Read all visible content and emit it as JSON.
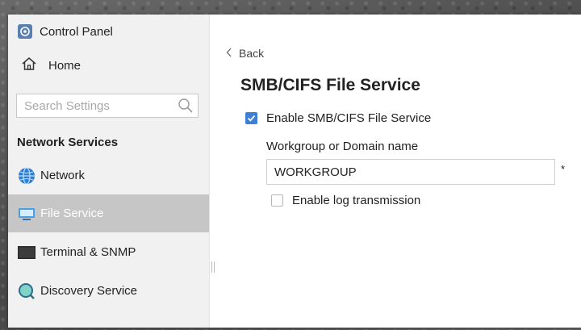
{
  "app": {
    "title": "Control Panel"
  },
  "sidebar": {
    "home_label": "Home",
    "search": {
      "placeholder": "Search Settings",
      "value": ""
    },
    "section_header": "Network Services",
    "items": [
      {
        "label": "Network",
        "icon": "globe-icon"
      },
      {
        "label": "File Service",
        "icon": "file-service-icon",
        "active": true
      },
      {
        "label": "Terminal & SNMP",
        "icon": "terminal-icon"
      },
      {
        "label": "Discovery Service",
        "icon": "discovery-icon"
      }
    ]
  },
  "main": {
    "back_label": "Back",
    "title": "SMB/CIFS File Service",
    "enable_smb": {
      "label": "Enable SMB/CIFS File Service",
      "checked": true
    },
    "workgroup": {
      "label": "Workgroup or Domain name",
      "value": "WORKGROUP",
      "required_mark": "*"
    },
    "enable_log": {
      "label": "Enable log transmission",
      "checked": false
    }
  },
  "colors": {
    "accent": "#3c7fd4",
    "sidebar_bg": "#f1f1f1",
    "active_item_bg": "#c6c6c6",
    "content_bg": "#ffffff"
  }
}
